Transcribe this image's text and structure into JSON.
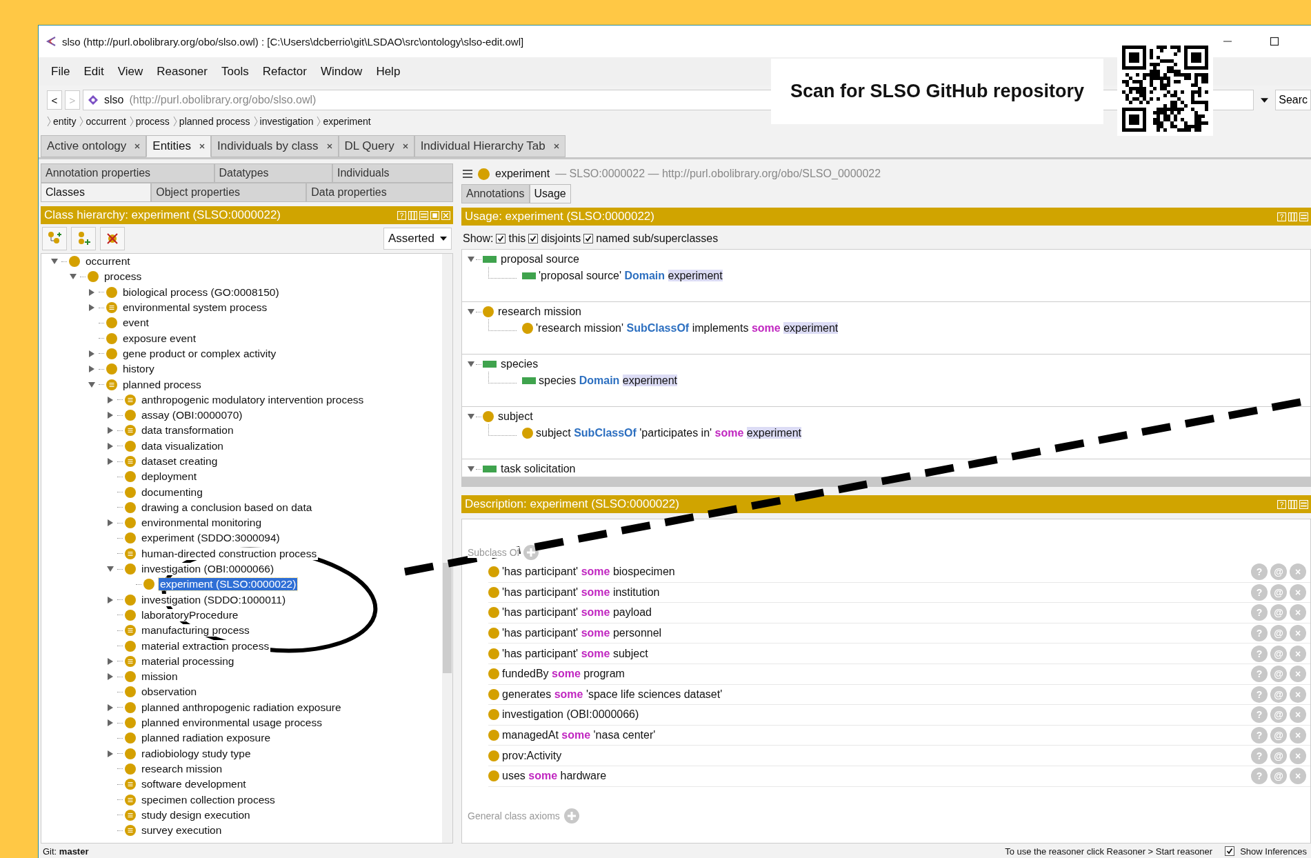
{
  "window": {
    "title": "slso (http://purl.obolibrary.org/obo/slso.owl)  : [C:\\Users\\dcberrio\\git\\LSDAO\\src\\ontology\\slso-edit.owl]"
  },
  "menu": [
    "File",
    "Edit",
    "View",
    "Reasoner",
    "Tools",
    "Refactor",
    "Window",
    "Help"
  ],
  "address": {
    "back": "<",
    "forward": ">",
    "forward_disabled": true,
    "name": "slso",
    "iri": "(http://purl.obolibrary.org/obo/slso.owl)",
    "search_button": "Searc"
  },
  "breadcrumb": [
    "entity",
    "occurrent",
    "process",
    "planned process",
    "investigation",
    "experiment"
  ],
  "tabs": [
    {
      "label": "Active ontology",
      "selected": false
    },
    {
      "label": "Entities",
      "selected": true
    },
    {
      "label": "Individuals by class",
      "selected": false
    },
    {
      "label": "DL Query",
      "selected": false
    },
    {
      "label": "Individual Hierarchy Tab",
      "selected": false
    }
  ],
  "overlay": {
    "caption": "Scan for SLSO GitHub repository"
  },
  "left_panel": {
    "tab_rows": [
      [
        {
          "label": "Annotation properties",
          "selected": false
        },
        {
          "label": "Datatypes",
          "selected": false
        },
        {
          "label": "Individuals",
          "selected": false
        }
      ],
      [
        {
          "label": "Classes",
          "selected": true
        },
        {
          "label": "Object properties",
          "selected": false
        },
        {
          "label": "Data properties",
          "selected": false
        }
      ]
    ],
    "header": "Class hierarchy: experiment (SLSO:0000022)",
    "mode": "Asserted",
    "tree": [
      {
        "label": "occurrent",
        "kind": "class",
        "expanded": true,
        "selected": false,
        "children": [
          {
            "label": "process",
            "kind": "class",
            "expanded": true,
            "selected": false,
            "children": [
              {
                "label": "biological process (GO:0008150)",
                "kind": "class",
                "expanded": false,
                "selected": false
              },
              {
                "label": "environmental system process",
                "kind": "defined",
                "expanded": false,
                "selected": false
              },
              {
                "label": "event",
                "kind": "class",
                "selected": false
              },
              {
                "label": "exposure event",
                "kind": "class",
                "selected": false
              },
              {
                "label": "gene product or complex activity",
                "kind": "class",
                "expanded": false,
                "selected": false
              },
              {
                "label": "history",
                "kind": "class",
                "expanded": false,
                "selected": false
              },
              {
                "label": "planned process",
                "kind": "defined",
                "expanded": true,
                "selected": false,
                "children": [
                  {
                    "label": "anthropogenic modulatory intervention process",
                    "kind": "defined",
                    "expanded": false,
                    "selected": false
                  },
                  {
                    "label": "assay (OBI:0000070)",
                    "kind": "class",
                    "expanded": false,
                    "selected": false
                  },
                  {
                    "label": "data transformation",
                    "kind": "defined",
                    "expanded": false,
                    "selected": false
                  },
                  {
                    "label": "data visualization",
                    "kind": "class",
                    "expanded": false,
                    "selected": false
                  },
                  {
                    "label": "dataset creating",
                    "kind": "defined",
                    "expanded": false,
                    "selected": false
                  },
                  {
                    "label": "deployment",
                    "kind": "class",
                    "selected": false
                  },
                  {
                    "label": "documenting",
                    "kind": "class",
                    "selected": false
                  },
                  {
                    "label": "drawing a conclusion based on data",
                    "kind": "class",
                    "selected": false
                  },
                  {
                    "label": "environmental monitoring",
                    "kind": "class",
                    "expanded": false,
                    "selected": false
                  },
                  {
                    "label": "experiment (SDDO:3000094)",
                    "kind": "class",
                    "selected": false
                  },
                  {
                    "label": "human-directed construction process",
                    "kind": "defined",
                    "selected": false
                  },
                  {
                    "label": "investigation (OBI:0000066)",
                    "kind": "class",
                    "expanded": true,
                    "selected": false,
                    "children": [
                      {
                        "label": "experiment (SLSO:0000022)",
                        "kind": "class",
                        "selected": true
                      }
                    ]
                  },
                  {
                    "label": "investigation (SDDO:1000011)",
                    "kind": "class",
                    "expanded": false,
                    "selected": false
                  },
                  {
                    "label": "laboratoryProcedure",
                    "kind": "class",
                    "selected": false
                  },
                  {
                    "label": "manufacturing process",
                    "kind": "defined",
                    "selected": false
                  },
                  {
                    "label": "material extraction process",
                    "kind": "class",
                    "selected": false
                  },
                  {
                    "label": "material processing",
                    "kind": "defined",
                    "expanded": false,
                    "selected": false
                  },
                  {
                    "label": "mission",
                    "kind": "class",
                    "expanded": false,
                    "selected": false
                  },
                  {
                    "label": "observation",
                    "kind": "class",
                    "selected": false
                  },
                  {
                    "label": "planned anthropogenic radiation exposure",
                    "kind": "class",
                    "expanded": false,
                    "selected": false
                  },
                  {
                    "label": "planned environmental usage process",
                    "kind": "class",
                    "expanded": false,
                    "selected": false
                  },
                  {
                    "label": "planned radiation exposure",
                    "kind": "class",
                    "selected": false
                  },
                  {
                    "label": "radiobiology study type",
                    "kind": "class",
                    "expanded": false,
                    "selected": false
                  },
                  {
                    "label": "research mission",
                    "kind": "class",
                    "selected": false
                  },
                  {
                    "label": "software development",
                    "kind": "defined",
                    "selected": false
                  },
                  {
                    "label": "specimen collection process",
                    "kind": "defined",
                    "selected": false
                  },
                  {
                    "label": "study design execution",
                    "kind": "defined",
                    "selected": false
                  },
                  {
                    "label": "survey execution",
                    "kind": "defined",
                    "selected": false
                  }
                ]
              }
            ]
          }
        ]
      }
    ]
  },
  "right_panel": {
    "entity": {
      "name": "experiment",
      "detail": "— SLSO:0000022 — http://purl.obolibrary.org/obo/SLSO_0000022"
    },
    "tabs": [
      {
        "label": "Annotations",
        "selected": false
      },
      {
        "label": "Usage",
        "selected": true
      }
    ],
    "usage": {
      "header": "Usage: experiment (SLSO:0000022)",
      "show_label": "Show:",
      "filters": [
        {
          "label": "this",
          "checked": true
        },
        {
          "label": "disjoints",
          "checked": true
        },
        {
          "label": "named sub/superclasses",
          "checked": true
        }
      ],
      "groups": [
        {
          "kind": "property",
          "label": "proposal source",
          "expanded": true,
          "axioms": [
            {
              "kind": "property",
              "parts": [
                {
                  "text": "'proposal source'",
                  "kind": "plain"
                },
                {
                  "text": "Domain",
                  "kind": "keyword"
                },
                {
                  "text": "experiment",
                  "kind": "highlight"
                }
              ]
            }
          ]
        },
        {
          "kind": "class",
          "label": "research mission",
          "expanded": true,
          "axioms": [
            {
              "kind": "class",
              "parts": [
                {
                  "text": "'research mission'",
                  "kind": "plain"
                },
                {
                  "text": "SubClassOf",
                  "kind": "keyword"
                },
                {
                  "text": "implements",
                  "kind": "plain"
                },
                {
                  "text": "some",
                  "kind": "quantifier"
                },
                {
                  "text": "experiment",
                  "kind": "highlight"
                }
              ]
            }
          ]
        },
        {
          "kind": "property",
          "label": "species",
          "expanded": true,
          "axioms": [
            {
              "kind": "property",
              "parts": [
                {
                  "text": "species",
                  "kind": "plain"
                },
                {
                  "text": "Domain",
                  "kind": "keyword"
                },
                {
                  "text": "experiment",
                  "kind": "highlight"
                }
              ]
            }
          ]
        },
        {
          "kind": "class",
          "label": "subject",
          "expanded": true,
          "axioms": [
            {
              "kind": "class",
              "parts": [
                {
                  "text": "subject",
                  "kind": "plain"
                },
                {
                  "text": "SubClassOf",
                  "kind": "keyword"
                },
                {
                  "text": "'participates in'",
                  "kind": "plain"
                },
                {
                  "text": "some",
                  "kind": "quantifier"
                },
                {
                  "text": "experiment",
                  "kind": "highlight"
                }
              ]
            }
          ]
        },
        {
          "kind": "property",
          "label": "task solicitation",
          "expanded": true
        }
      ]
    },
    "description": {
      "header": "Description: experiment (SLSO:0000022)",
      "subclass_title": "Subclass Of",
      "items": [
        {
          "kind": "class",
          "parts": [
            {
              "text": "'has participant'",
              "kind": "plain"
            },
            {
              "text": "some",
              "kind": "quantifier"
            },
            {
              "text": "biospecimen",
              "kind": "plain"
            }
          ],
          "buttons": [
            "?",
            "@",
            "×"
          ]
        },
        {
          "kind": "class",
          "parts": [
            {
              "text": "'has participant'",
              "kind": "plain"
            },
            {
              "text": "some",
              "kind": "quantifier"
            },
            {
              "text": "institution",
              "kind": "plain"
            }
          ],
          "buttons": [
            "?",
            "@",
            "×"
          ]
        },
        {
          "kind": "class",
          "parts": [
            {
              "text": "'has participant'",
              "kind": "plain"
            },
            {
              "text": "some",
              "kind": "quantifier"
            },
            {
              "text": "payload",
              "kind": "plain"
            }
          ],
          "buttons": [
            "?",
            "@",
            "×"
          ]
        },
        {
          "kind": "class",
          "parts": [
            {
              "text": "'has participant'",
              "kind": "plain"
            },
            {
              "text": "some",
              "kind": "quantifier"
            },
            {
              "text": "personnel",
              "kind": "plain"
            }
          ],
          "buttons": [
            "?",
            "@",
            "×"
          ]
        },
        {
          "kind": "class",
          "parts": [
            {
              "text": "'has participant'",
              "kind": "plain"
            },
            {
              "text": "some",
              "kind": "quantifier"
            },
            {
              "text": "subject",
              "kind": "plain"
            }
          ],
          "buttons": [
            "?",
            "@",
            "×"
          ]
        },
        {
          "kind": "class",
          "parts": [
            {
              "text": "fundedBy",
              "kind": "plain"
            },
            {
              "text": "some",
              "kind": "quantifier"
            },
            {
              "text": "program",
              "kind": "plain"
            }
          ],
          "buttons": [
            "?",
            "@",
            "×"
          ]
        },
        {
          "kind": "class",
          "parts": [
            {
              "text": "generates",
              "kind": "plain"
            },
            {
              "text": "some",
              "kind": "quantifier"
            },
            {
              "text": "'space life sciences dataset'",
              "kind": "plain"
            }
          ],
          "buttons": [
            "?",
            "@",
            "×"
          ]
        },
        {
          "kind": "class",
          "parts": [
            {
              "text": "investigation (OBI:0000066)",
              "kind": "plain"
            }
          ],
          "buttons": [
            "?",
            "@",
            "×"
          ]
        },
        {
          "kind": "class",
          "parts": [
            {
              "text": "managedAt",
              "kind": "plain"
            },
            {
              "text": "some",
              "kind": "quantifier"
            },
            {
              "text": "'nasa center'",
              "kind": "plain"
            }
          ],
          "buttons": [
            "?",
            "@",
            "×"
          ]
        },
        {
          "kind": "class",
          "parts": [
            {
              "text": "prov:Activity",
              "kind": "plain"
            }
          ],
          "buttons": [
            "?",
            "@",
            "×"
          ]
        },
        {
          "kind": "class",
          "parts": [
            {
              "text": "uses",
              "kind": "plain"
            },
            {
              "text": "some",
              "kind": "quantifier"
            },
            {
              "text": "hardware",
              "kind": "plain"
            }
          ],
          "buttons": [
            "?",
            "@",
            "×"
          ]
        }
      ],
      "general_title": "General class axioms"
    }
  },
  "status_bar": {
    "git": "Git: **master**",
    "reasoner_hint": "To use the reasoner click Reasoner > Start reasoner",
    "show_inferences": {
      "label": "Show Inferences",
      "checked": true
    }
  }
}
